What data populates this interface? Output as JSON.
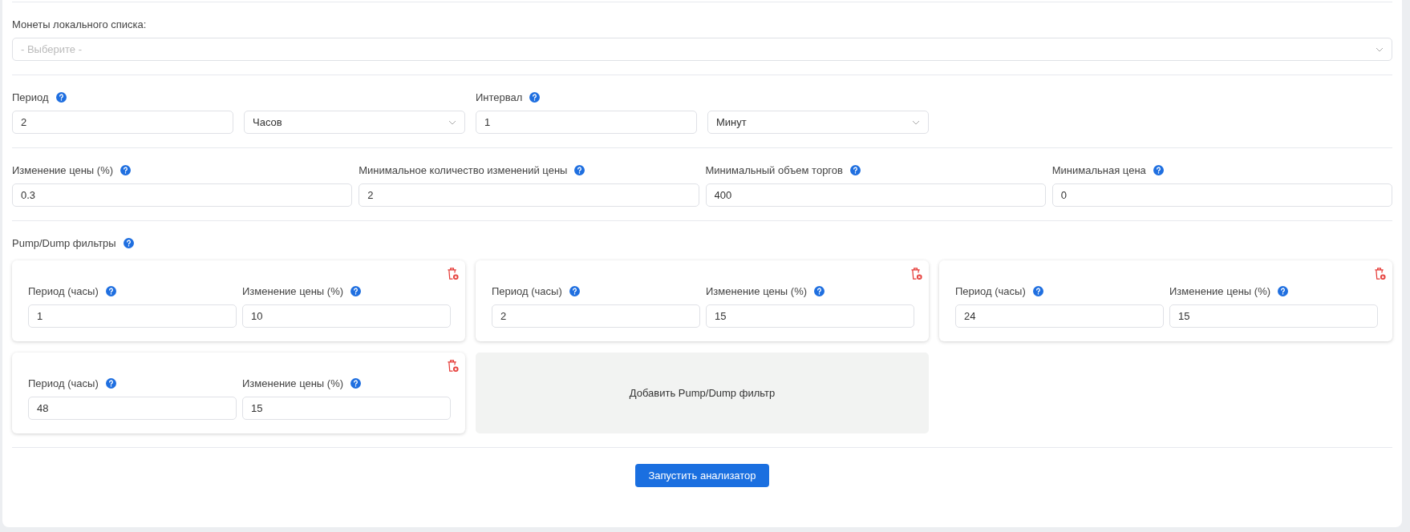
{
  "coins": {
    "label": "Монеты локального списка:",
    "placeholder": "- Выберите -"
  },
  "timing": [
    {
      "label": "Период",
      "value": "2",
      "unit": "Часов"
    },
    {
      "label": "Интервал",
      "value": "1",
      "unit": "Минут"
    }
  ],
  "limits": [
    {
      "label": "Изменение цены (%)",
      "value": "0.3"
    },
    {
      "label": "Минимальное количество изменений цены",
      "value": "2"
    },
    {
      "label": "Минимальный объем торгов",
      "value": "400"
    },
    {
      "label": "Минимальная цена",
      "value": "0"
    }
  ],
  "pump_dump": {
    "label": "Pump/Dump фильтры",
    "filters": [
      {
        "period_label": "Период (часы)",
        "period_value": "1",
        "change_label": "Изменение цены (%)",
        "change_value": "10"
      },
      {
        "period_label": "Период (часы)",
        "period_value": "2",
        "change_label": "Изменение цены (%)",
        "change_value": "15"
      },
      {
        "period_label": "Период (часы)",
        "period_value": "24",
        "change_label": "Изменение цены (%)",
        "change_value": "15"
      },
      {
        "period_label": "Период (часы)",
        "period_value": "48",
        "change_label": "Изменение цены (%)",
        "change_value": "15"
      }
    ],
    "add_label": "Добавить Pump/Dump фильтр"
  },
  "run_button": "Запустить анализатор"
}
